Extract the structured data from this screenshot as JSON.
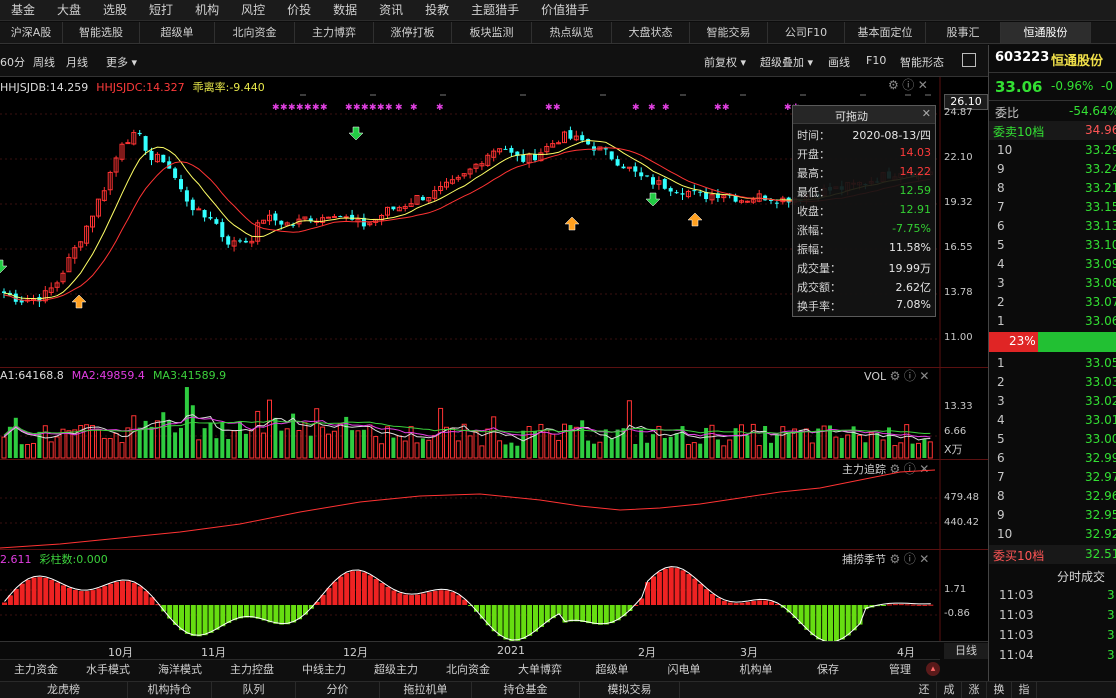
{
  "top_menu": [
    "基金",
    "大盘",
    "选股",
    "短打",
    "机构",
    "风控",
    "价投",
    "数据",
    "资讯",
    "投教",
    "主题猎手",
    "价值猎手"
  ],
  "tabs": [
    {
      "label": "沪深A股"
    },
    {
      "label": "智能选股"
    },
    {
      "label": "超级单"
    },
    {
      "label": "北向资金"
    },
    {
      "label": "主力博弈"
    },
    {
      "label": "涨停打板"
    },
    {
      "label": "板块监测"
    },
    {
      "label": "热点纵览"
    },
    {
      "label": "大盘状态"
    },
    {
      "label": "智能交易"
    },
    {
      "label": "公司F10"
    },
    {
      "label": "基本面定位"
    },
    {
      "label": "股事汇"
    },
    {
      "label": "恒通股份",
      "active": true
    }
  ],
  "toolbar": {
    "left": [
      "60分",
      "周线",
      "月线",
      "更多 ▾"
    ],
    "right": [
      "前复权 ▾",
      "超级叠加 ▾",
      "画线",
      "F10",
      "智能形态"
    ]
  },
  "indicators": {
    "main": [
      {
        "text": "HHJSJDB:14.259",
        "color": "#dcdcdc"
      },
      {
        "text": "HHJSJDC:14.327",
        "color": "#ff3b3b"
      },
      {
        "text": "乖离率:-9.440",
        "color": "#e8e84a"
      }
    ],
    "vol": [
      {
        "text": "A1:64168.8",
        "color": "#dcdcdc"
      },
      {
        "text": "MA2:49859.4",
        "color": "#e23de2"
      },
      {
        "text": "MA3:41589.9",
        "color": "#3cd03c"
      }
    ],
    "vol_name": "VOL",
    "track_name": "主力追踪",
    "season_name": "捕捞季节",
    "season": [
      {
        "text": "2.611",
        "color": "#e23de2"
      },
      {
        "text": "彩柱数:0.000",
        "color": "#3cd03c"
      }
    ]
  },
  "axes": {
    "main": [
      "24.87",
      "22.10",
      "19.32",
      "16.55",
      "13.78",
      "11.00"
    ],
    "main_current": "26.10",
    "vol": [
      "13.33",
      "6.66"
    ],
    "vol_unit": "X万",
    "track": [
      "479.48",
      "440.42"
    ],
    "season": [
      "1.71",
      "-0.86"
    ],
    "x_months": [
      "10月",
      "11月",
      "12月",
      "2021",
      "2月",
      "3月",
      "4月"
    ],
    "daily_label": "日线"
  },
  "tooltip": {
    "title": "可拖动",
    "rows": [
      {
        "label": "时间：",
        "value": "2020-08-13/四",
        "color": "#e6e6e6"
      },
      {
        "label": "开盘：",
        "value": "14.03",
        "color": "#ff3b3b"
      },
      {
        "label": "最高：",
        "value": "14.22",
        "color": "#ff3b3b"
      },
      {
        "label": "最低：",
        "value": "12.59",
        "color": "#33d033"
      },
      {
        "label": "收盘：",
        "value": "12.91",
        "color": "#33d033"
      },
      {
        "label": "涨幅：",
        "value": "-7.75%",
        "color": "#33d033"
      },
      {
        "label": "振幅：",
        "value": "11.58%",
        "color": "#e6e6e6"
      },
      {
        "label": "成交量：",
        "value": "19.99万",
        "color": "#e6e6e6"
      },
      {
        "label": "成交额：",
        "value": "2.62亿",
        "color": "#e6e6e6"
      },
      {
        "label": "换手率：",
        "value": "7.08%",
        "color": "#e6e6e6"
      }
    ]
  },
  "right_panel": {
    "code": "603223",
    "name": "恒通股份",
    "price": "33.06",
    "change_pct": "-0.96%",
    "change": "-0",
    "ratio_label": "委比",
    "ratio_value": "-54.64%",
    "sell_label": "委卖10档",
    "sell_total": "34.96",
    "sell": [
      {
        "level": "10",
        "price": "33.29"
      },
      {
        "level": "9",
        "price": "33.24"
      },
      {
        "level": "8",
        "price": "33.21"
      },
      {
        "level": "7",
        "price": "33.15"
      },
      {
        "level": "6",
        "price": "33.13"
      },
      {
        "level": "5",
        "price": "33.10"
      },
      {
        "level": "4",
        "price": "33.09"
      },
      {
        "level": "3",
        "price": "33.08"
      },
      {
        "level": "2",
        "price": "33.07"
      },
      {
        "level": "1",
        "price": "33.06"
      }
    ],
    "bar_pct": "23%",
    "buy": [
      {
        "level": "1",
        "price": "33.05"
      },
      {
        "level": "2",
        "price": "33.03"
      },
      {
        "level": "3",
        "price": "33.02"
      },
      {
        "level": "4",
        "price": "33.01"
      },
      {
        "level": "5",
        "price": "33.00"
      },
      {
        "level": "6",
        "price": "32.99"
      },
      {
        "level": "7",
        "price": "32.97"
      },
      {
        "level": "8",
        "price": "32.96"
      },
      {
        "level": "9",
        "price": "32.95"
      },
      {
        "level": "10",
        "price": "32.92"
      }
    ],
    "buy_label": "委买10档",
    "buy_total": "32.51",
    "trades_title": "分时成交",
    "trades": [
      {
        "time": "11:03",
        "price": "3"
      },
      {
        "time": "11:03",
        "price": "3"
      },
      {
        "time": "11:03",
        "price": "3"
      },
      {
        "time": "11:04",
        "price": "3"
      }
    ]
  },
  "bottom_tabs": [
    "主力资金",
    "水手模式",
    "海洋模式",
    "主力控盘",
    "中线主力",
    "超级主力",
    "北向资金",
    "大单博弈",
    "超级单",
    "闪电单",
    "机构单",
    "保存",
    "管理"
  ],
  "status_bar": [
    "龙虎榜",
    "机构持仓",
    "队列",
    "分价",
    "拖拉机单",
    "持仓基金",
    "模拟交易"
  ],
  "status_right": [
    "还",
    "成",
    "涨",
    "换",
    "指"
  ],
  "colors": {
    "up": "#ff3333",
    "down": "#33ffff",
    "vol_down": "#2ecc40",
    "ma_fast": "#ffff66",
    "ma_slow": "#ff3333",
    "marker": "#e040e0"
  }
}
